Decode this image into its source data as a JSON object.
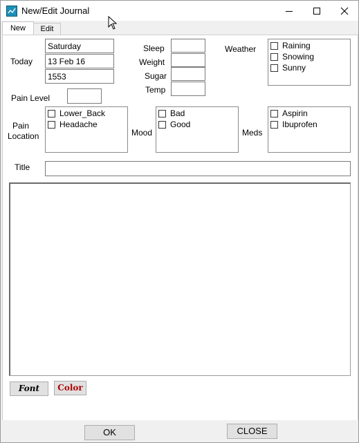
{
  "window": {
    "title": "New/Edit Journal"
  },
  "tabs": [
    {
      "label": "New"
    },
    {
      "label": "Edit"
    }
  ],
  "form": {
    "today_label": "Today",
    "day": "Saturday",
    "date": "13 Feb 16",
    "time": "1553",
    "sleep_label": "Sleep",
    "weight_label": "Weight",
    "sugar_label": "Sugar",
    "temp_label": "Temp",
    "weather_label": "Weather",
    "weather_options": [
      "Raining",
      "Snowing",
      "Sunny"
    ],
    "pain_level_label": "Pain Level",
    "pain_location_label_1": "Pain",
    "pain_location_label_2": "Location",
    "pain_location_options": [
      "Lower_Back",
      "Headache"
    ],
    "mood_label": "Mood",
    "mood_options": [
      "Bad",
      "Good"
    ],
    "meds_label": "Meds",
    "meds_options": [
      "Aspirin",
      "Ibuprofen"
    ],
    "title_label": "Title",
    "title_value": "",
    "body_text": ""
  },
  "toolbar": {
    "font_label": "Font",
    "color_label": "Color"
  },
  "footer": {
    "ok_label": "OK",
    "close_label": "CLOSE"
  },
  "colors": {
    "color_button_text": "#b00000",
    "app_icon": "#1e8fb7"
  }
}
